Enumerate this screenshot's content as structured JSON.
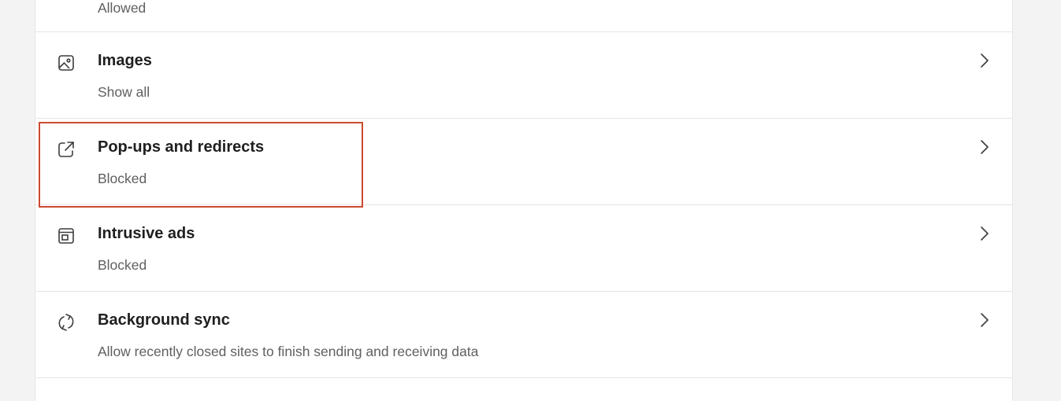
{
  "top_row": {
    "subtitle": "Allowed"
  },
  "rows": [
    {
      "title": "Images",
      "subtitle": "Show all",
      "icon": "image-icon"
    },
    {
      "title": "Pop-ups and redirects",
      "subtitle": "Blocked",
      "icon": "external-link-icon"
    },
    {
      "title": "Intrusive ads",
      "subtitle": "Blocked",
      "icon": "ad-window-icon"
    },
    {
      "title": "Background sync",
      "subtitle": "Allow recently closed sites to finish sending and receiving data",
      "icon": "sync-icon"
    }
  ],
  "colors": {
    "highlight": "#cc4a32",
    "title": "#1f1f1f",
    "subtitle": "#5f5f5f",
    "background": "#f3f3f3",
    "card": "#ffffff"
  }
}
